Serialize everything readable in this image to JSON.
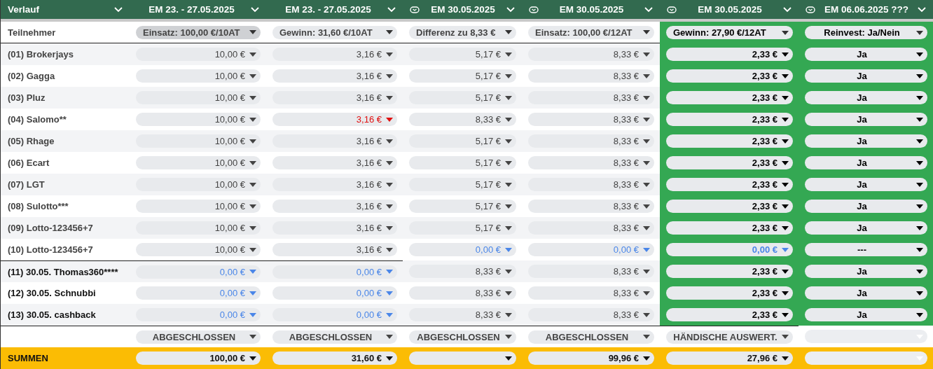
{
  "columns": [
    {
      "title": "Verlauf"
    },
    {
      "title": "EM 23. - 27.05.2025",
      "linked": false,
      "kind": "amount",
      "highlighted": false,
      "filter": {
        "text": "Einsatz: 100,00 €/10AT",
        "selected": true
      }
    },
    {
      "title": "EM 23. - 27.05.2025",
      "linked": false,
      "kind": "amount",
      "highlighted": false,
      "filter": {
        "text": "Gewinn: 31,60 €/10AT",
        "selected": false
      }
    },
    {
      "title": "EM 30.05.2025",
      "linked": true,
      "kind": "amount",
      "highlighted": false,
      "filter": {
        "text": "Differenz zu 8,33 €",
        "selected": false
      }
    },
    {
      "title": "EM 30.05.2025",
      "linked": true,
      "kind": "amount",
      "highlighted": false,
      "filter": {
        "text": "Einsatz: 100,00 €/12AT",
        "selected": false
      }
    },
    {
      "title": "EM 30.05.2025",
      "linked": true,
      "kind": "amount",
      "highlighted": true,
      "filter": {
        "text": "Gewinn: 27,90 €/12AT",
        "selected": false
      }
    },
    {
      "title": "EM 06.06.2025 ???",
      "linked": true,
      "kind": "choice",
      "highlighted": true,
      "filter": {
        "text": "Reinvest: Ja/Nein",
        "selected": false
      }
    }
  ],
  "participants_label": "Teilnehmer",
  "rows": [
    {
      "name": "(01) Brokerjays",
      "kind": "regular",
      "cells": [
        {
          "value": "10,00 €",
          "kind": "plain"
        },
        {
          "value": "3,16 €",
          "kind": "plain"
        },
        {
          "value": "5,17 €",
          "kind": "plain"
        },
        {
          "value": "8,33 €",
          "kind": "plain"
        },
        {
          "value": "2,33 €",
          "kind": "plain"
        },
        {
          "value": "Ja",
          "kind": "plain"
        }
      ]
    },
    {
      "name": "(02) Gagga",
      "kind": "regular",
      "cells": [
        {
          "value": "10,00 €",
          "kind": "plain"
        },
        {
          "value": "3,16 €",
          "kind": "plain"
        },
        {
          "value": "5,17 €",
          "kind": "plain"
        },
        {
          "value": "8,33 €",
          "kind": "plain"
        },
        {
          "value": "2,33 €",
          "kind": "plain"
        },
        {
          "value": "Ja",
          "kind": "plain"
        }
      ]
    },
    {
      "name": "(03) Pluz",
      "kind": "regular",
      "cells": [
        {
          "value": "10,00 €",
          "kind": "plain"
        },
        {
          "value": "3,16 €",
          "kind": "plain"
        },
        {
          "value": "5,17 €",
          "kind": "plain"
        },
        {
          "value": "8,33 €",
          "kind": "plain"
        },
        {
          "value": "2,33 €",
          "kind": "plain"
        },
        {
          "value": "Ja",
          "kind": "plain"
        }
      ]
    },
    {
      "name": "(04) Salomo**",
      "kind": "regular",
      "cells": [
        {
          "value": "10,00 €",
          "kind": "plain"
        },
        {
          "value": "3,16 €",
          "kind": "red"
        },
        {
          "value": "8,33 €",
          "kind": "plain"
        },
        {
          "value": "8,33 €",
          "kind": "plain"
        },
        {
          "value": "2,33 €",
          "kind": "plain"
        },
        {
          "value": "Ja",
          "kind": "plain"
        }
      ]
    },
    {
      "name": "(05) Rhage",
      "kind": "regular",
      "cells": [
        {
          "value": "10,00 €",
          "kind": "plain"
        },
        {
          "value": "3,16 €",
          "kind": "plain"
        },
        {
          "value": "5,17 €",
          "kind": "plain"
        },
        {
          "value": "8,33 €",
          "kind": "plain"
        },
        {
          "value": "2,33 €",
          "kind": "plain"
        },
        {
          "value": "Ja",
          "kind": "plain"
        }
      ]
    },
    {
      "name": "(06) Ecart",
      "kind": "regular",
      "cells": [
        {
          "value": "10,00 €",
          "kind": "plain"
        },
        {
          "value": "3,16 €",
          "kind": "plain"
        },
        {
          "value": "5,17 €",
          "kind": "plain"
        },
        {
          "value": "8,33 €",
          "kind": "plain"
        },
        {
          "value": "2,33 €",
          "kind": "plain"
        },
        {
          "value": "Ja",
          "kind": "plain"
        }
      ]
    },
    {
      "name": "(07) LGT",
      "kind": "regular",
      "cells": [
        {
          "value": "10,00 €",
          "kind": "plain"
        },
        {
          "value": "3,16 €",
          "kind": "plain"
        },
        {
          "value": "5,17 €",
          "kind": "plain"
        },
        {
          "value": "8,33 €",
          "kind": "plain"
        },
        {
          "value": "2,33 €",
          "kind": "plain"
        },
        {
          "value": "Ja",
          "kind": "plain"
        }
      ]
    },
    {
      "name": "(08) Sulotto***",
      "kind": "regular",
      "cells": [
        {
          "value": "10,00 €",
          "kind": "plain"
        },
        {
          "value": "3,16 €",
          "kind": "plain"
        },
        {
          "value": "5,17 €",
          "kind": "plain"
        },
        {
          "value": "8,33 €",
          "kind": "plain"
        },
        {
          "value": "2,33 €",
          "kind": "plain"
        },
        {
          "value": "Ja",
          "kind": "plain"
        }
      ]
    },
    {
      "name": "(09) Lotto-123456+7",
      "kind": "regular",
      "cells": [
        {
          "value": "10,00 €",
          "kind": "plain"
        },
        {
          "value": "3,16 €",
          "kind": "plain"
        },
        {
          "value": "5,17 €",
          "kind": "plain"
        },
        {
          "value": "8,33 €",
          "kind": "plain"
        },
        {
          "value": "2,33 €",
          "kind": "plain"
        },
        {
          "value": "Ja",
          "kind": "plain"
        }
      ]
    },
    {
      "name": "(10) Lotto-123456+7",
      "kind": "regular",
      "cells": [
        {
          "value": "10,00 €",
          "kind": "plain"
        },
        {
          "value": "3,16 €",
          "kind": "plain"
        },
        {
          "value": "0,00 €",
          "kind": "blue"
        },
        {
          "value": "0,00 €",
          "kind": "blue"
        },
        {
          "value": "0,00 €",
          "kind": "blue"
        },
        {
          "value": "---",
          "kind": "plain"
        }
      ]
    },
    {
      "name": "(11) 30.05. Thomas360****",
      "kind": "added",
      "cells": [
        {
          "value": "0,00 €",
          "kind": "blue"
        },
        {
          "value": "0,00 €",
          "kind": "blue"
        },
        {
          "value": "8,33 €",
          "kind": "plain"
        },
        {
          "value": "8,33 €",
          "kind": "plain"
        },
        {
          "value": "2,33 €",
          "kind": "plain"
        },
        {
          "value": "Ja",
          "kind": "plain"
        }
      ]
    },
    {
      "name": "(12) 30.05. Schnubbi",
      "kind": "added",
      "cells": [
        {
          "value": "0,00 €",
          "kind": "blue"
        },
        {
          "value": "0,00 €",
          "kind": "blue"
        },
        {
          "value": "8,33 €",
          "kind": "plain"
        },
        {
          "value": "8,33 €",
          "kind": "plain"
        },
        {
          "value": "2,33 €",
          "kind": "plain"
        },
        {
          "value": "Ja",
          "kind": "plain"
        }
      ]
    },
    {
      "name": "(13) 30.05. cashback",
      "kind": "added",
      "cells": [
        {
          "value": "0,00 €",
          "kind": "blue"
        },
        {
          "value": "0,00 €",
          "kind": "blue"
        },
        {
          "value": "8,33 €",
          "kind": "plain"
        },
        {
          "value": "8,33 €",
          "kind": "plain"
        },
        {
          "value": "2,33 €",
          "kind": "plain"
        },
        {
          "value": "Ja",
          "kind": "plain"
        }
      ]
    }
  ],
  "status": [
    {
      "text": "ABGESCHLOSSEN",
      "disabled": false
    },
    {
      "text": "ABGESCHLOSSEN",
      "disabled": false
    },
    {
      "text": "ABGESCHLOSSEN",
      "disabled": false
    },
    {
      "text": "ABGESCHLOSSEN",
      "disabled": false
    },
    {
      "text": "HÄNDISCHE AUSWERT.",
      "disabled": false
    },
    {
      "disabled": true
    }
  ],
  "sums": {
    "label": "SUMMEN",
    "cells": [
      {
        "value": "100,00 €",
        "disabled": false
      },
      {
        "value": "31,60 €",
        "disabled": false
      },
      {
        "disabled": false
      },
      {
        "value": "99,96 €",
        "disabled": false
      },
      {
        "value": "27,96 €",
        "disabled": false
      },
      {
        "disabled": true
      }
    ]
  }
}
